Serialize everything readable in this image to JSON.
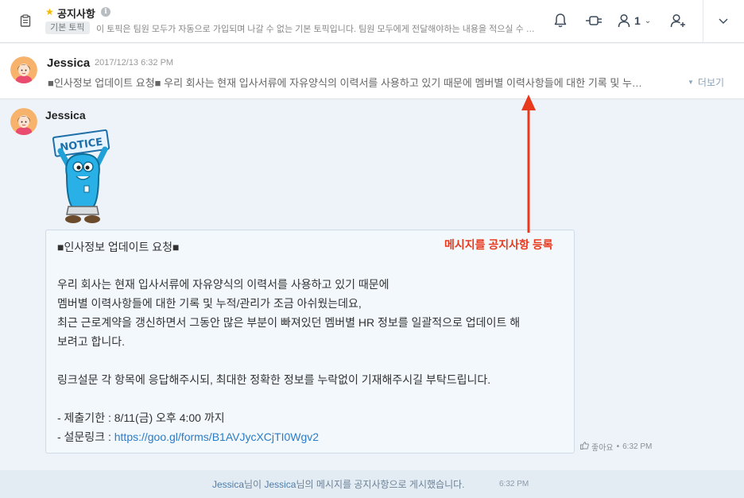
{
  "header": {
    "title": "공지사항",
    "tag": "기본 토픽",
    "description": "이 토픽은 팀원 모두가 자동으로 가입되며 나갈 수 없는 기본 토픽입니다. 팀원 모두에게 전달해야하는 내용을 적으실 수 있습니다.",
    "member_count": "1"
  },
  "notice": {
    "author": "Jessica",
    "timestamp": "2017/12/13 6:32 PM",
    "text": "■인사정보 업데이트 요청■ 우리 회사는 현재 입사서류에 자유양식의 이력서를 사용하고 있기 때문에 멤버별 이력사항들에 대한 기록 및 누적/관리가 조금 아쉬웠는데요,",
    "more_label": "더보기"
  },
  "message": {
    "author": "Jessica",
    "sticker_text": "NOTICE",
    "lines": [
      "■인사정보 업데이트 요청■",
      "우리 회사는 현재 입사서류에 자유양식의 이력서를 사용하고 있기 때문에",
      "멤버별 이력사항들에 대한 기록 및 누적/관리가 조금 아쉬웠는데요,",
      "최근 근로계약을 갱신하면서 그동안 많은 부분이 빠져있던 멤버별 HR 정보를 일괄적으로 업데이트 해",
      "보려고 합니다.",
      "링크설문 각 항목에 응답해주시되,  최대한 정확한 정보를 누락없이 기재해주시길 부탁드립니다.",
      "- 제출기한 :  8/11(금) 오후 4:00 까지"
    ],
    "link_prefix": "- 설문링크 : ",
    "link_url": "https://goo.gl/forms/B1AVJycXCjTI0Wgv2",
    "like_label": "좋아요",
    "meta_sep": "•",
    "time": "6:32 PM"
  },
  "annotation": {
    "label": "메시지를 공지사항 등록",
    "color": "#e8391d"
  },
  "system": {
    "user1": "Jessica",
    "mid": "님이 ",
    "user2": "Jessica",
    "rest": "님의 메시지를 공지사항으로 게시했습니다.",
    "time": "6:32 PM"
  },
  "icons": [
    "clipboard-icon",
    "star-icon",
    "info-icon",
    "bell-icon",
    "plug-icon",
    "user-icon",
    "add-user-icon",
    "chevron-down-icon",
    "thumbs-up-icon"
  ]
}
